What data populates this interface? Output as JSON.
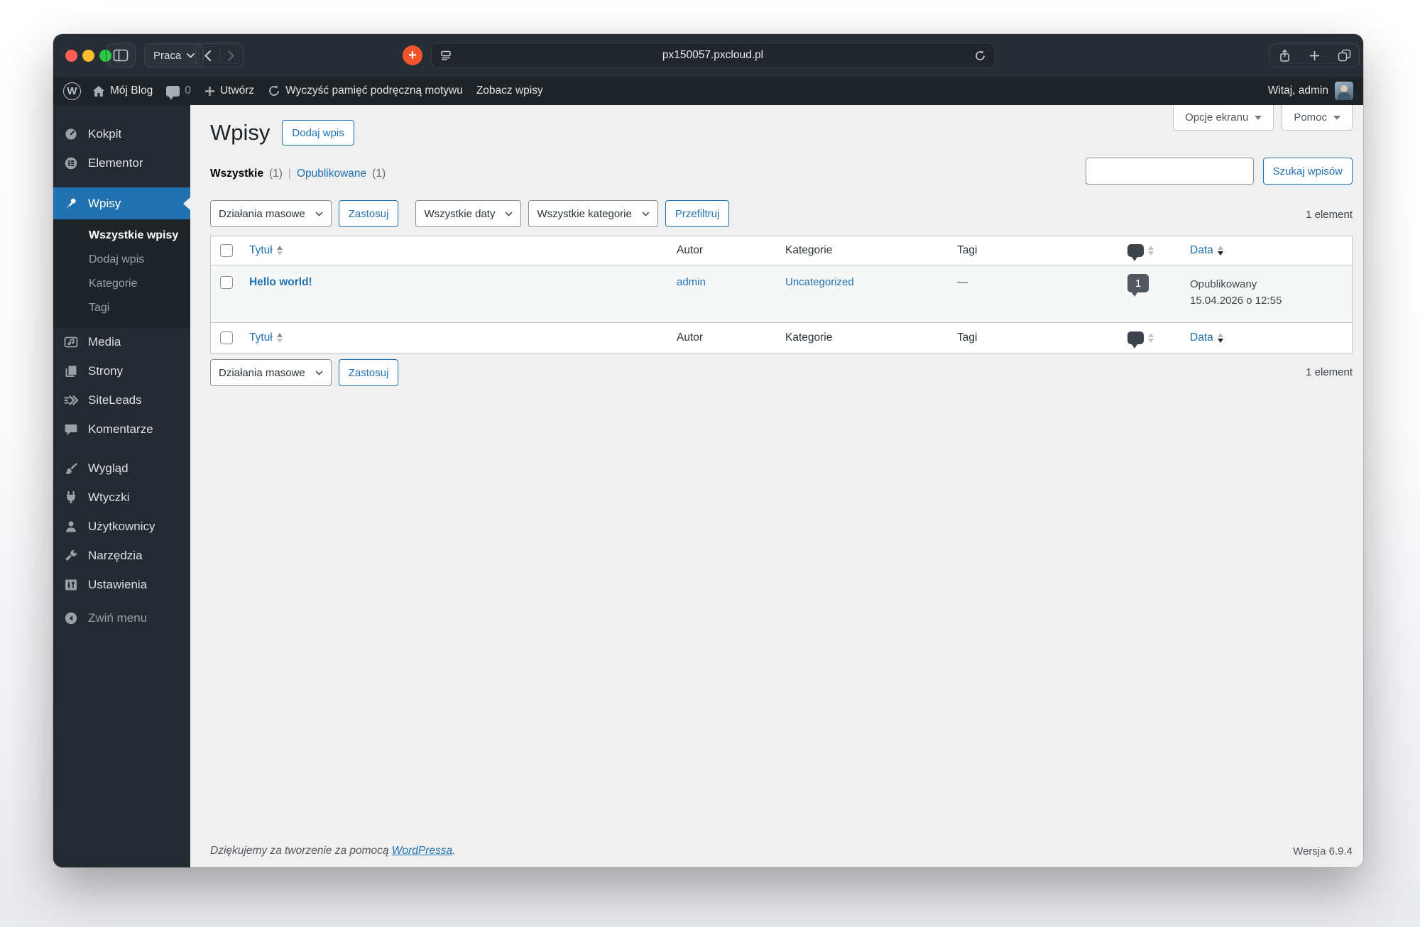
{
  "colors": {
    "accent": "#2271b1",
    "toolbar_bg": "#262d34",
    "admin_bar_bg": "#1d2327",
    "sidebar_bg": "#242a31",
    "submenu_bg": "#1d2327",
    "content_bg": "#f0f0f1",
    "extension_orange": "#f2552c",
    "traffic_red": "#ff5f57",
    "traffic_yellow": "#febc2e",
    "traffic_green": "#28c840"
  },
  "browser": {
    "tab_group_label": "Praca",
    "url": "px150057.pxcloud.pl"
  },
  "admin_bar": {
    "wp_logo_letter": "W",
    "site_name": "Mój Blog",
    "comment_count": "0",
    "new_content_label": "Utwórz",
    "clear_cache_label": "Wyczyść pamięć podręczną motywu",
    "view_posts_label": "Zobacz wpisy",
    "greeting": "Witaj, admin"
  },
  "sidebar": {
    "items": [
      {
        "label": "Kokpit",
        "icon": "dashboard-icon"
      },
      {
        "label": "Elementor",
        "icon": "elementor-icon"
      },
      {
        "label": "Wpisy",
        "icon": "pushpin-icon"
      },
      {
        "label": "Media",
        "icon": "media-icon"
      },
      {
        "label": "Strony",
        "icon": "pages-icon"
      },
      {
        "label": "SiteLeads",
        "icon": "siteleads-icon"
      },
      {
        "label": "Komentarze",
        "icon": "comments-icon"
      },
      {
        "label": "Wygląd",
        "icon": "appearance-icon"
      },
      {
        "label": "Wtyczki",
        "icon": "plugins-icon"
      },
      {
        "label": "Użytkownicy",
        "icon": "users-icon"
      },
      {
        "label": "Narzędzia",
        "icon": "tools-icon"
      },
      {
        "label": "Ustawienia",
        "icon": "settings-icon"
      },
      {
        "label": "Zwiń menu",
        "icon": "collapse-icon"
      }
    ],
    "wpisy_submenu": [
      {
        "label": "Wszystkie wpisy",
        "current": true
      },
      {
        "label": "Dodaj wpis",
        "current": false
      },
      {
        "label": "Kategorie",
        "current": false
      },
      {
        "label": "Tagi",
        "current": false
      }
    ]
  },
  "page": {
    "title": "Wpisy",
    "add_new_label": "Dodaj wpis",
    "screen_options_label": "Opcje ekranu",
    "help_label": "Pomoc",
    "views": {
      "all_label": "Wszystkie",
      "all_count": "(1)",
      "separator": "|",
      "published_label": "Opublikowane",
      "published_count": "(1)"
    },
    "search_button_label": "Szukaj wpisów",
    "bulk_actions_label": "Działania masowe",
    "apply_label": "Zastosuj",
    "all_dates_label": "Wszystkie daty",
    "all_categories_label": "Wszystkie kategorie",
    "filter_label": "Przefiltruj",
    "item_count": "1 element",
    "table": {
      "headers": {
        "title": "Tytuł",
        "author": "Autor",
        "categories": "Kategorie",
        "tags": "Tagi",
        "date": "Data"
      },
      "rows": [
        {
          "title": "Hello world!",
          "author": "admin",
          "categories": "Uncategorized",
          "tags": "—",
          "comment_count": "1",
          "status": "Opublikowany",
          "date": "15.04.2026 o 12:55"
        }
      ]
    },
    "footer": {
      "thanks_prefix": "Dziękujemy za tworzenie za pomocą ",
      "wordpress_link": "WordPressa",
      "thanks_suffix": ".",
      "version": "Wersja 6.9.4"
    }
  }
}
